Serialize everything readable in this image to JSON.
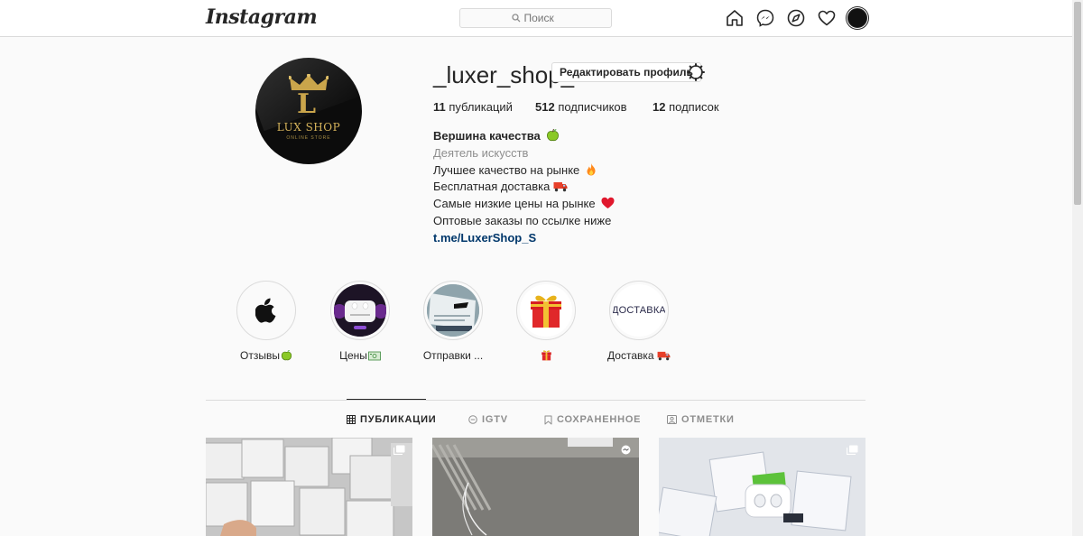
{
  "nav": {
    "logo": "Instagram",
    "search_placeholder": "Поиск",
    "icons": [
      "home-icon",
      "messenger-icon",
      "explore-icon",
      "heart-icon",
      "avatar"
    ]
  },
  "profile": {
    "username": "_luxer_shop_",
    "edit_button": "Редактировать профиль",
    "avatar_brand": "LUX SHOP",
    "avatar_brand_letter": "L",
    "avatar_brand_sub": "ONLINE STORE",
    "stats": {
      "posts_count": "11",
      "posts_label": "публикаций",
      "followers_count": "512",
      "followers_label": "подписчиков",
      "following_count": "12",
      "following_label": "подписок"
    },
    "bio": {
      "name": "Вершина качества",
      "category": "Деятель искусств",
      "lines": [
        "Лучшее качество на рынке",
        "Бесплатная доставка",
        "Самые низкие цены на рынке",
        "Оптовые заказы по ссылке ниже"
      ],
      "link": "t.me/LuxerShop_S"
    }
  },
  "highlights": [
    {
      "label": "Отзывы",
      "icon": "apple-icon"
    },
    {
      "label": "Цены",
      "icon": "airpods-icon"
    },
    {
      "label": "Отправки ...",
      "icon": "package-photo"
    },
    {
      "label": "",
      "icon": "gift-icon"
    },
    {
      "label": "Доставка",
      "cover_text": "ДОСТАВКА"
    }
  ],
  "tabs": [
    {
      "label": "ПУБЛИКАЦИИ",
      "active": true
    },
    {
      "label": "IGTV",
      "active": false
    },
    {
      "label": "СОХРАНЕННОЕ",
      "active": false
    },
    {
      "label": "ОТМЕТКИ",
      "active": false
    }
  ],
  "posts": [
    {
      "type": "carousel"
    },
    {
      "type": "igtv"
    },
    {
      "type": "carousel"
    }
  ],
  "colors": {
    "text": "#262626",
    "muted": "#8e8e8e",
    "link": "#00376b",
    "border": "#dbdbdb",
    "gold": "#caa54b"
  }
}
